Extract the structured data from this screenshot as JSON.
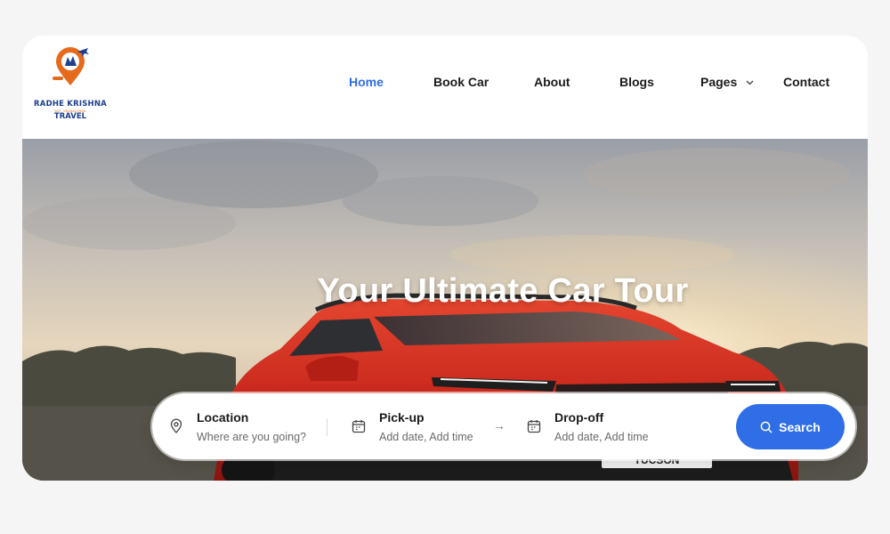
{
  "brand": {
    "name": "RADHE KRISHNA",
    "phone": "MO. 9925822559",
    "sub": "TRAVEL",
    "colors": {
      "navy": "#1d3f8e",
      "orange": "#e46b1e"
    }
  },
  "nav": {
    "items": [
      {
        "label": "Home",
        "active": true
      },
      {
        "label": "Book Car",
        "active": false
      },
      {
        "label": "About",
        "active": false
      },
      {
        "label": "Blogs",
        "active": false
      },
      {
        "label": "Pages",
        "active": false,
        "has_dropdown": true
      },
      {
        "label": "Contact",
        "active": false
      }
    ],
    "active_color": "#2f6ee6"
  },
  "hero": {
    "title": "Your Ultimate Car Tour",
    "plate_text": "TUCSON"
  },
  "search": {
    "location": {
      "label": "Location",
      "placeholder": "Where are you going?",
      "icon": "map-pin-icon"
    },
    "pickup": {
      "label": "Pick-up",
      "placeholder": "Add date, Add time",
      "icon": "calendar-icon"
    },
    "dropoff": {
      "label": "Drop-off",
      "placeholder": "Add date, Add time",
      "icon": "calendar-icon"
    },
    "button_label": "Search",
    "button_color": "#2f6ee6"
  }
}
